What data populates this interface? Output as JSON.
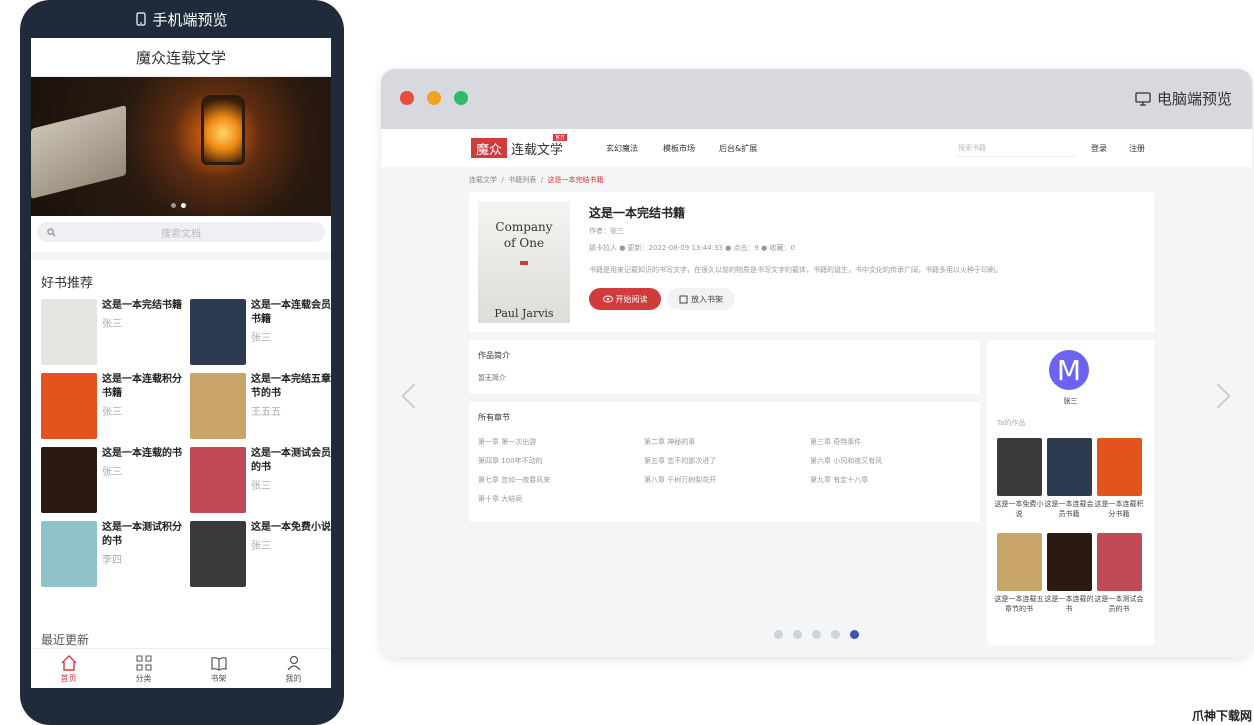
{
  "mobile": {
    "caption": "手机端预览",
    "site_title": "魔众连载文学",
    "search_placeholder": "搜索文档",
    "section_title": "好书推荐",
    "books": [
      {
        "title": "这是一本完结书籍",
        "author": "张三",
        "cover": "#e6e4df"
      },
      {
        "title": "这是一本连载会员书籍",
        "author": "张三",
        "cover": "#2c3a52"
      },
      {
        "title": "这是一本连载积分书籍",
        "author": "张三",
        "cover": "#e2541c"
      },
      {
        "title": "这是一本完结五章节的书",
        "author": "王五五",
        "cover": "#c9a469"
      },
      {
        "title": "这是一本连载的书",
        "author": "张三",
        "cover": "#2a1a12"
      },
      {
        "title": "这是一本测试会员的书",
        "author": "张三",
        "cover": "#c24a55"
      },
      {
        "title": "这是一本测试积分的书",
        "author": "李四",
        "cover": "#8ec3c8"
      },
      {
        "title": "这是一本免费小说",
        "author": "张三",
        "cover": "#3a3a3a"
      }
    ],
    "latest_title": "最近更新",
    "tabs": [
      {
        "label": "首页",
        "icon": "home-icon"
      },
      {
        "label": "分类",
        "icon": "grid-icon"
      },
      {
        "label": "书架",
        "icon": "book-icon"
      },
      {
        "label": "我的",
        "icon": "user-icon"
      }
    ]
  },
  "desktop": {
    "caption": "电脑端预览",
    "logo_box": "魔众",
    "logo_text": "连载文学",
    "logo_tag": "官方",
    "nav": [
      "玄幻魔法",
      "模板市场",
      "后台&扩展"
    ],
    "search_placeholder": "搜索书籍",
    "login": "登录",
    "register": "注册",
    "breadcrumb": [
      "连载文学",
      "书籍列表",
      "这是一本完结书籍"
    ],
    "book": {
      "cover_title": "Company of One",
      "cover_author": "Paul Jarvis",
      "title": "这是一本完结书籍",
      "author": "作者：张三",
      "meta": "那卡拉人 ● 更新：2022-08-09 13:44:33 ● 点击：9 ● 收藏：0",
      "desc": "书籍是用来记载知识的书写文字，在很久以前的物质是书写文字的载体，书籍的诞生，书中文化的传承广阔，书籍多用以火种于印刷。",
      "read_button": "开始阅读",
      "shelf_button": "放入书架"
    },
    "intro_title": "作品简介",
    "intro_text": "暂无简介",
    "chapters_title": "所有章节",
    "chapters": [
      "第一章 第一次出游",
      "第二章 神秘的事",
      "第三章 奇特事件",
      "第四章 100年不动的",
      "第五章 恋不的那次进了",
      "第六章 小冈和夜又有风",
      "第七章 忽如一夜春风来",
      "第八章 千树万树梨花开",
      "第九章 有定十八章",
      "第十章 大结局"
    ],
    "user_initial": "M",
    "user_name": "张三",
    "other_works_title": "Ta的作品",
    "side_books": [
      {
        "title": "这是一本免费小说",
        "cover": "#3a3a3a"
      },
      {
        "title": "这是一本连载会员书籍",
        "cover": "#2c3a52"
      },
      {
        "title": "这是一本连载积分书籍",
        "cover": "#e2541c"
      },
      {
        "title": "这是一本连载五章节的书",
        "cover": "#c9a469"
      },
      {
        "title": "这是一本连载的书",
        "cover": "#2a1a12"
      },
      {
        "title": "这是一本测试会员的书",
        "cover": "#c24a55"
      }
    ]
  },
  "watermark": "爪神下载网",
  "colors": {
    "accent": "#d23b3b",
    "dot_active": "#3f51b5"
  }
}
